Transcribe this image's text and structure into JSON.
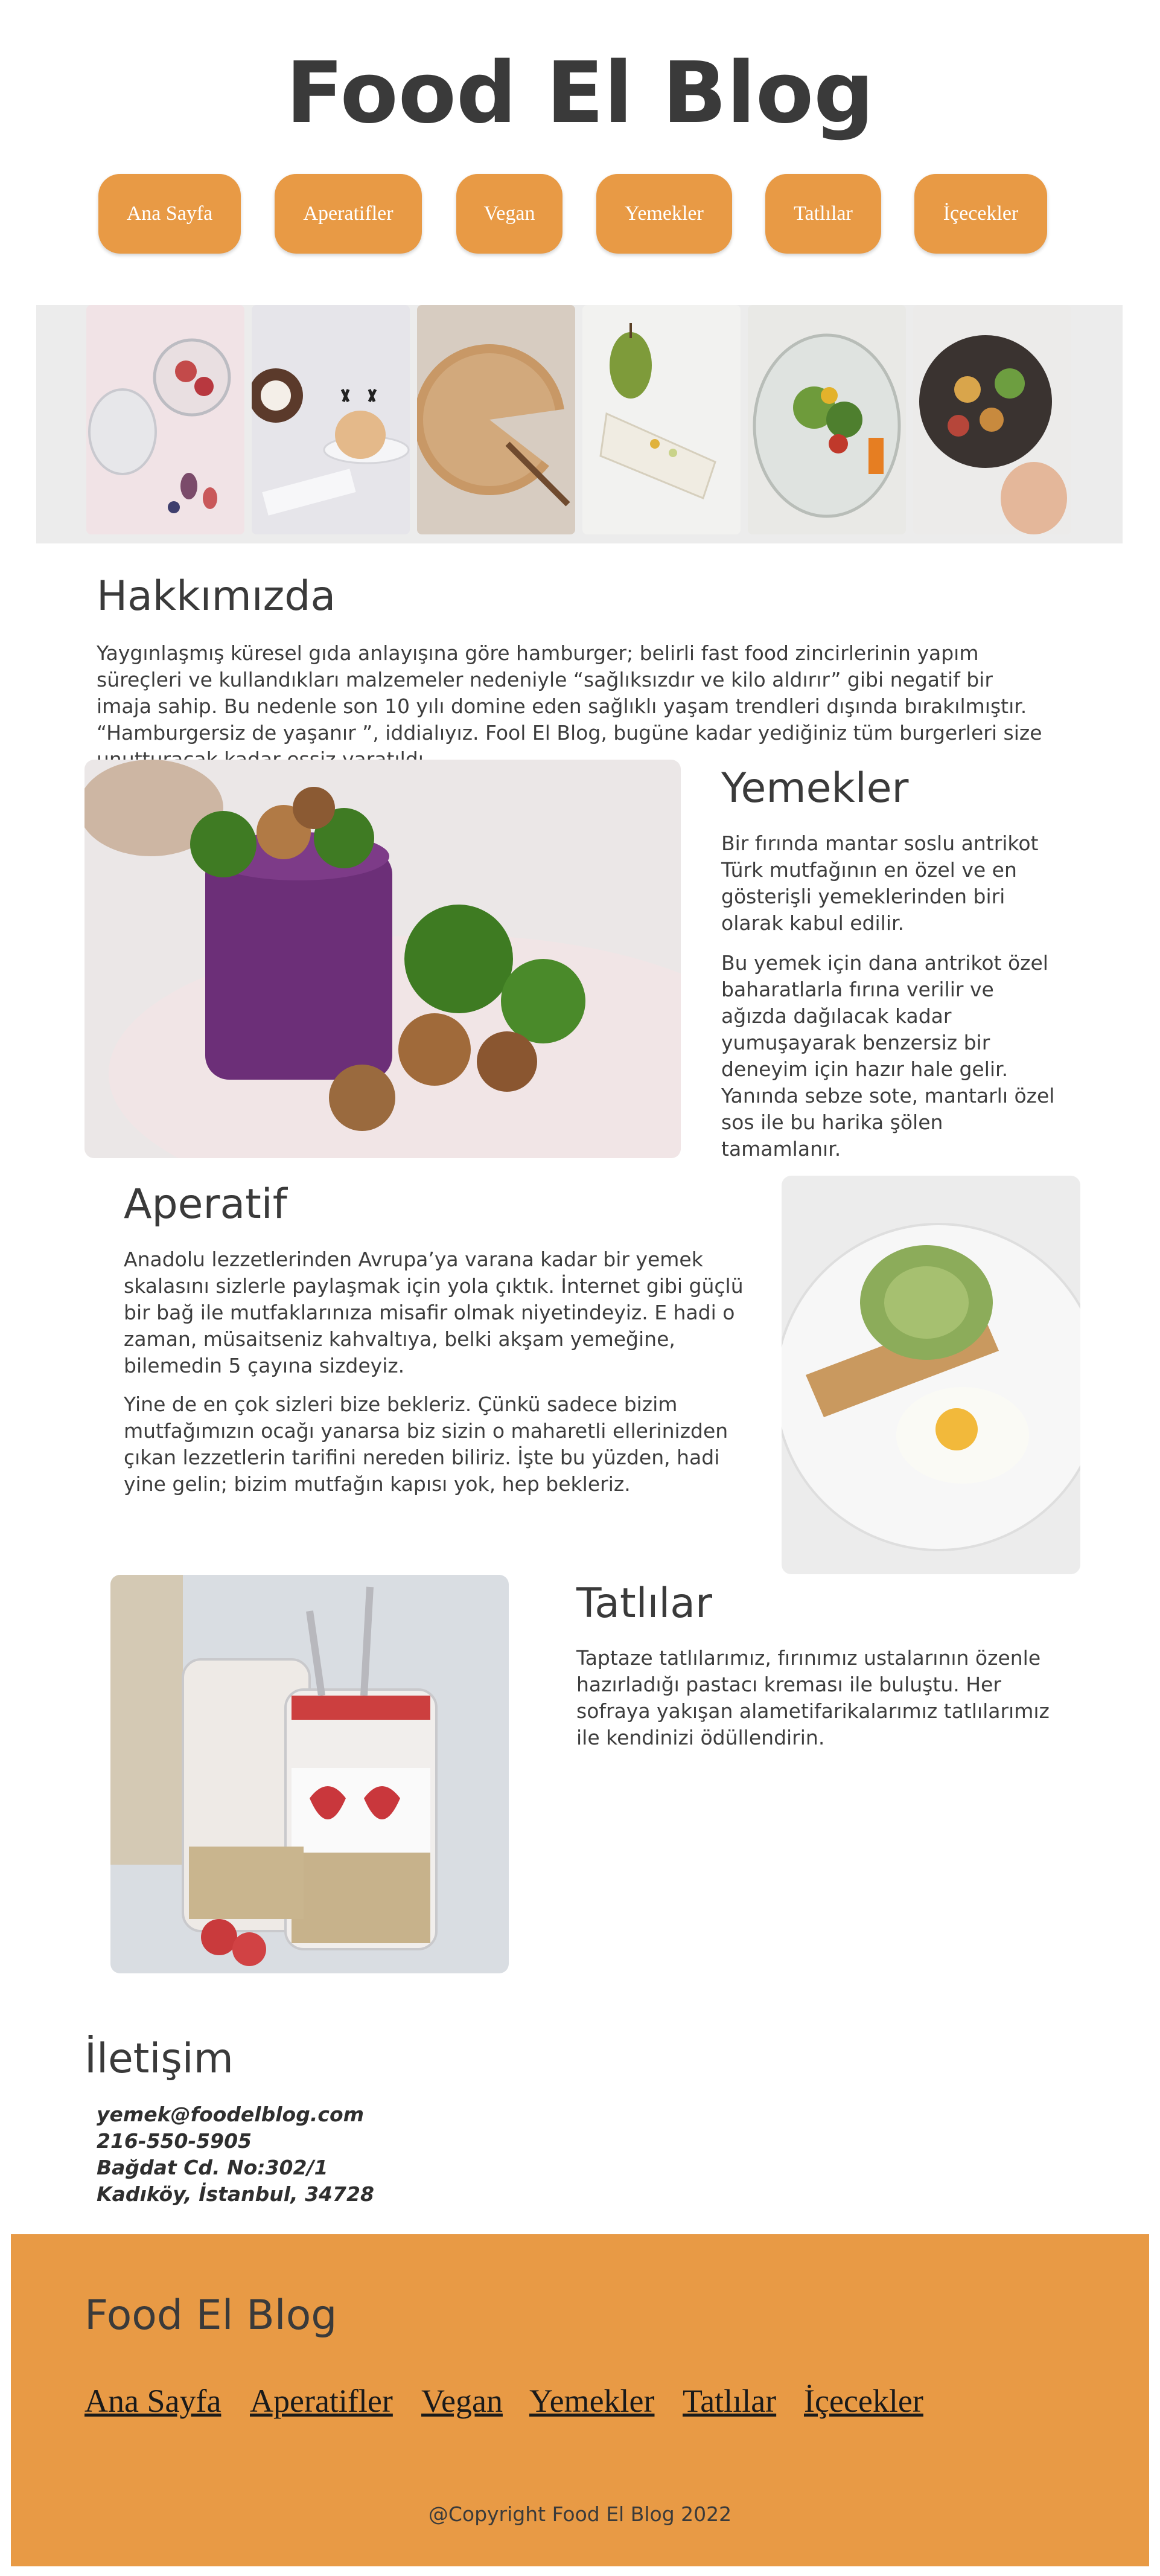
{
  "header": {
    "title": "Food El Blog"
  },
  "nav": {
    "items": [
      {
        "label": "Ana Sayfa"
      },
      {
        "label": "Aperatifler"
      },
      {
        "label": "Vegan"
      },
      {
        "label": "Yemekler"
      },
      {
        "label": "Tatlılar"
      },
      {
        "label": "İçecekler"
      }
    ]
  },
  "about": {
    "title": "Hakkımızda",
    "text": "Yaygınlaşmış küresel gıda anlayışına göre hamburger; belirli fast food zincirlerinin yapım süreçleri ve kullandıkları malzemeler nedeniyle “sağlıksızdır ve kilo aldırır” gibi negatif bir imaja sahip. Bu nedenle son 10 yılı domine eden sağlıklı yaşam trendleri dışında bırakılmıştır. “Hamburgersiz de yaşanır ”, iddialıyız. Fool El Blog, bugüne kadar yediğiniz tüm burgerleri size unutturacak kadar eşsiz yaratıldı."
  },
  "mains": {
    "title": "Yemekler",
    "p1": "Bir fırında mantar soslu antrikot Türk mutfağının en özel ve en gösterişli yemeklerinden biri olarak kabul edilir.",
    "p2": "Bu yemek için dana antrikot özel baharatlarla fırına verilir ve ağızda dağılacak kadar yumuşayarak benzersiz bir deneyim için hazır hale gelir. Yanında sebze sote, mantarlı özel sos ile bu harika şölen tamamlanır."
  },
  "appetizer": {
    "title": "Aperatif",
    "p1": "Anadolu lezzetlerinden Avrupa’ya varana kadar bir yemek skalasını sizlerle paylaşmak için yola çıktık. İnternet gibi güçlü bir bağ ile mutfaklarınıza misafir olmak niyetindeyiz. E hadi o zaman, müsaitseniz kahvaltıya, belki akşam yemeğine, bilemedin 5 çayına sizdeyiz.",
    "p2": "Yine de en çok sizleri bize bekleriz. Çünkü sadece bizim mutfağımızın ocağı yanarsa biz sizin o maharetli ellerinizden çıkan lezzetlerin tarifini nereden biliriz. İşte bu yüzden, hadi yine gelin; bizim mutfağın kapısı yok, hep bekleriz."
  },
  "desserts": {
    "title": "Tatlılar",
    "text": "Taptaze tatlılarımız, fırınımız ustalarının özenle hazırladığı pastacı kreması ile buluştu. Her sofraya yakışan alametifarikalarımız tatlılarımız ile kendinizi ödüllendirin."
  },
  "contact": {
    "title": "İletişim",
    "email": "yemek@foodelblog.com",
    "phone": "216-550-5905",
    "address1": "Bağdat Cd. No:302/1",
    "address2": "Kadıköy, İstanbul, 34728"
  },
  "footer": {
    "title": "Food El Blog",
    "links": [
      "Ana Sayfa",
      "Aperatifler",
      "Vegan",
      "Yemekler",
      "Tatlılar",
      "İçecekler"
    ],
    "copyright": "@Copyright Food El Blog 2022"
  },
  "colors": {
    "accent": "#e89a45",
    "text": "#3a3a3a",
    "gallery_bg": "#ececec"
  }
}
